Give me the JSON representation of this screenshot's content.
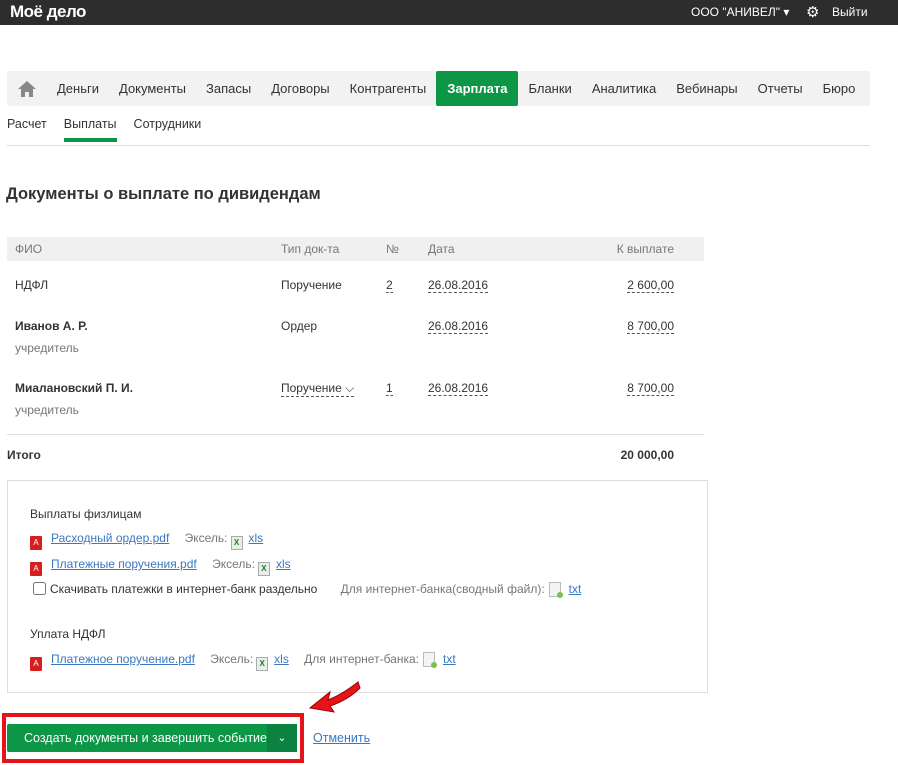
{
  "header": {
    "logo": "Моё дело",
    "org": "ООО \"АНИВЕЛ\" ▾",
    "logout": "Выйти"
  },
  "nav": {
    "items": [
      "Деньги",
      "Документы",
      "Запасы",
      "Договоры",
      "Контрагенты",
      "Зарплата",
      "Бланки",
      "Аналитика",
      "Вебинары",
      "Отчеты",
      "Бюро"
    ],
    "active": "Зарплата"
  },
  "subtabs": {
    "items": [
      "Расчет",
      "Выплаты",
      "Сотрудники"
    ],
    "active": "Выплаты"
  },
  "page_title": "Документы о выплате по дивидендам",
  "table": {
    "headers": [
      "ФИО",
      "Тип док-та",
      "№",
      "Дата",
      "К выплате"
    ],
    "rows": [
      {
        "name": "НДФЛ",
        "role": "",
        "type": "Поручение",
        "num": "2",
        "date": "26.08.2016",
        "amount": "2 600,00"
      },
      {
        "name": "Иванов А. Р.",
        "role": "учредитель",
        "type": "Ордер",
        "num": "",
        "date": "26.08.2016",
        "amount": "8 700,00"
      },
      {
        "name": "Миалановский П. И.",
        "role": "учредитель",
        "type": "Поручение ⌵",
        "num": "1",
        "date": "26.08.2016",
        "amount": "8 700,00"
      }
    ],
    "total_label": "Итого",
    "total": "20 000,00"
  },
  "docs": {
    "section1": "Выплаты физлицам",
    "doc1": "Расходный ордер.pdf",
    "doc2": "Платежные поручения.pdf",
    "excel": "Эксель:",
    "xls": "xls",
    "txt": "txt",
    "checkbox": "Скачивать платежки в интернет-банк раздельно",
    "bank_summary": "Для интернет-банка(сводный файл):",
    "section2": "Уплата НДФЛ",
    "doc3": "Платежное поручение.pdf",
    "bank": "Для интернет-банка:"
  },
  "actions": {
    "submit": "Создать документы и завершить событие",
    "cancel": "Отменить"
  },
  "colors": {
    "accent": "#0e9647",
    "highlight": "#e5141b"
  }
}
